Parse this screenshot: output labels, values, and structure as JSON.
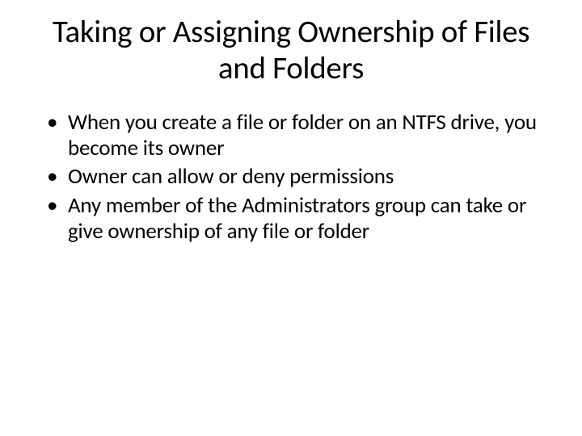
{
  "slide": {
    "title": "Taking or Assigning Ownership of Files and Folders",
    "bullets": [
      "When you create a file or folder on an NTFS drive, you become its owner",
      "Owner can allow or deny permissions",
      "Any member of the Administrators group can take or give ownership of any file or folder"
    ]
  }
}
